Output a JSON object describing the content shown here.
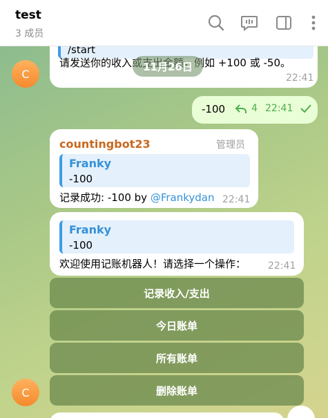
{
  "header": {
    "title": "test",
    "subtitle": "3 成员",
    "icons": [
      "search-icon",
      "voice-chat-icon",
      "sidebar-icon",
      "more-vertical-icon"
    ]
  },
  "chat": {
    "date_pill": "11月26日",
    "msg1": {
      "top_fragment": "/start",
      "text": "请发送你的收入或支出金额，例如 +100 或 -50。",
      "time": "22:41"
    },
    "msg2": {
      "text": "-100",
      "reply_count": "4",
      "time": "22:41"
    },
    "msg3": {
      "sender": "countingbot23",
      "role": "管理员",
      "quote_name": "Franky",
      "quote_text": "-100",
      "text": "记录成功: -100 by",
      "mention": "@Frankydan",
      "time": "22:41"
    },
    "msg4": {
      "quote_name": "Franky",
      "quote_text": "-100",
      "text": "欢迎使用记账机器人！请选择一个操作：",
      "time": "22:41"
    },
    "keyboard": [
      "记录收入/支出",
      "今日账单",
      "所有账单",
      "删除账单"
    ],
    "avatar_letter": "C"
  },
  "colors": {
    "sender_name": "#c9681e",
    "link": "#3491d8",
    "outgoing_bubble": "#e9fdd6",
    "accent_check": "#4fae4e"
  }
}
